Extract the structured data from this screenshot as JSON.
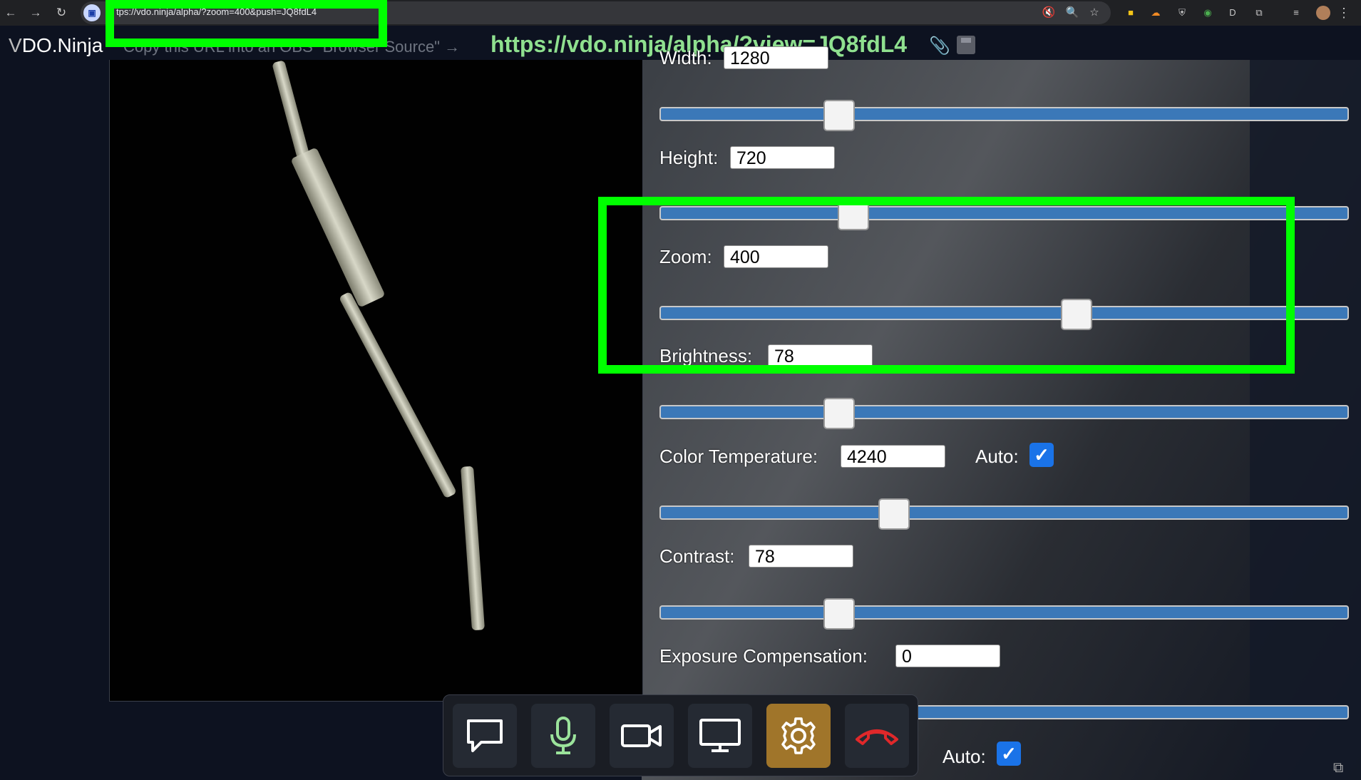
{
  "browser": {
    "url": "tps://vdo.ninja/alpha/?zoom=400&push=JQ8fdL4",
    "back_icon": "back-arrow-icon",
    "forward_icon": "forward-arrow-icon",
    "reload_icon": "reload-icon"
  },
  "header": {
    "brand_v": "V",
    "brand_rest": "DO.Ninja",
    "copy_hint": "Copy this URL into an OBS \"Browser Source\" →",
    "view_link": "https://vdo.ninja/alpha/?view=JQ8fdL4"
  },
  "settings": {
    "width": {
      "label": "Width:",
      "value": "1280",
      "slider_fraction": 0.26
    },
    "height": {
      "label": "Height:",
      "value": "720",
      "slider_fraction": 0.28
    },
    "zoom": {
      "label": "Zoom:",
      "value": "400",
      "slider_fraction": 0.605
    },
    "brightness": {
      "label": "Brightness:",
      "value": "78",
      "slider_fraction": 0.26
    },
    "color_temperature": {
      "label": "Color Temperature:",
      "value": "4240",
      "slider_fraction": 0.34,
      "auto_label": "Auto:",
      "auto_checked": true
    },
    "contrast": {
      "label": "Contrast:",
      "value": "78",
      "slider_fraction": 0.26
    },
    "exposure_compensation": {
      "label": "Exposure Compensation:",
      "value": "0"
    },
    "bottom_auto_label": "Auto:"
  },
  "controls": [
    {
      "name": "chat-icon"
    },
    {
      "name": "microphone-icon"
    },
    {
      "name": "camera-icon"
    },
    {
      "name": "screen-share-icon"
    },
    {
      "name": "settings-gear-icon",
      "active": true
    },
    {
      "name": "hang-up-icon"
    }
  ],
  "colors": {
    "highlight": "#00ff00",
    "slider_track": "#3b78b8",
    "view_link": "#8fe08f",
    "active_control": "#a0752a",
    "hangup": "#e0282a"
  }
}
